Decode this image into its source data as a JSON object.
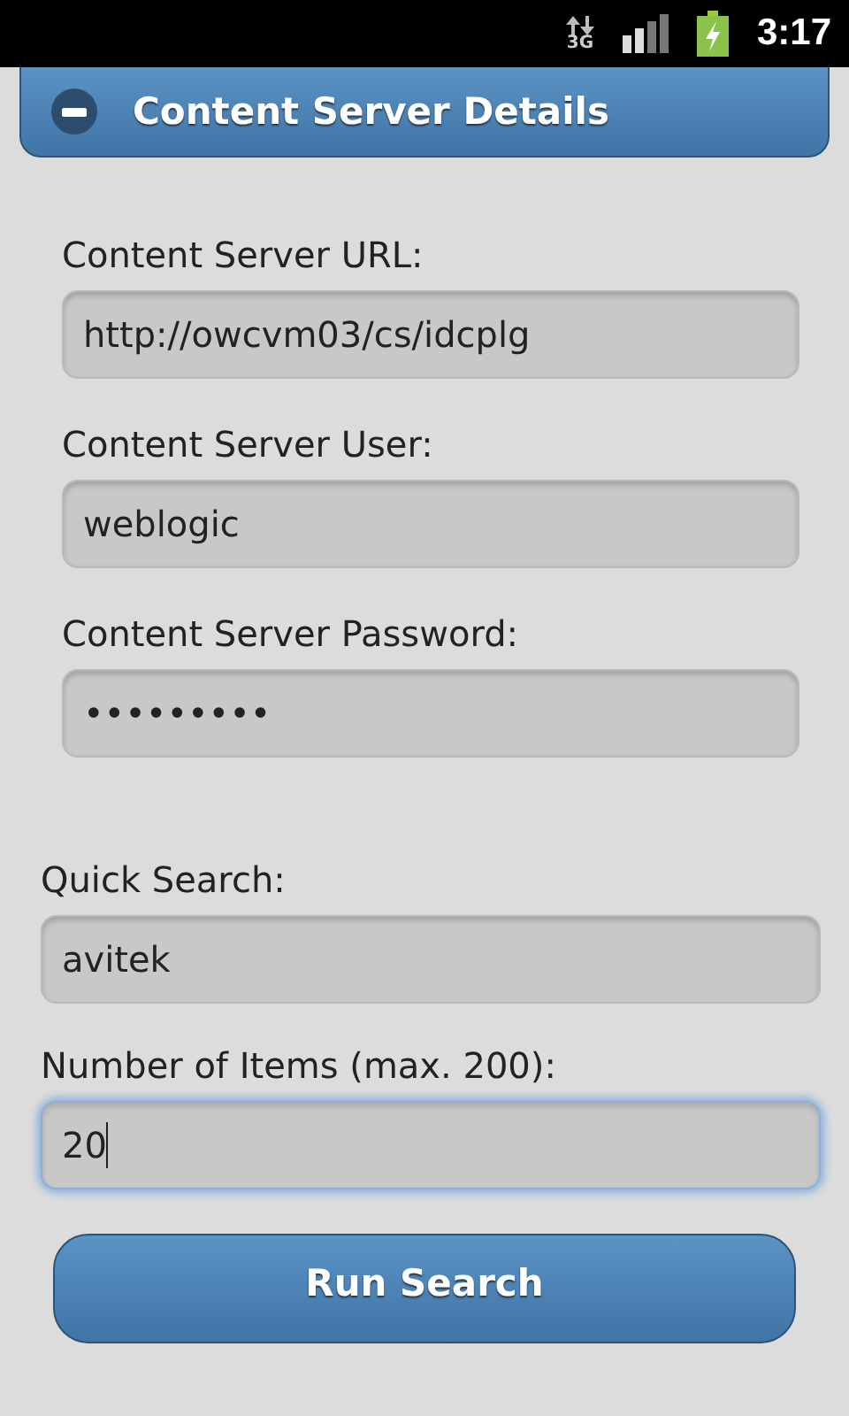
{
  "status_bar": {
    "network": "3G",
    "time": "3:17"
  },
  "section": {
    "title": "Content Server Details",
    "expanded": true,
    "fields": [
      {
        "label": "Content Server URL:",
        "value": "http://owcvm03/cs/idcplg",
        "focused": false
      },
      {
        "label": "Content Server User:",
        "value": "weblogic",
        "focused": false
      },
      {
        "label": "Content Server Password:",
        "value": "•••••••••",
        "focused": false
      }
    ]
  },
  "fields": [
    {
      "label": "Quick Search:",
      "value": "avitek",
      "focused": false
    },
    {
      "label": "Number of Items (max. 200):",
      "value": "20",
      "focused": true
    }
  ],
  "buttons": [
    "Run Search"
  ]
}
